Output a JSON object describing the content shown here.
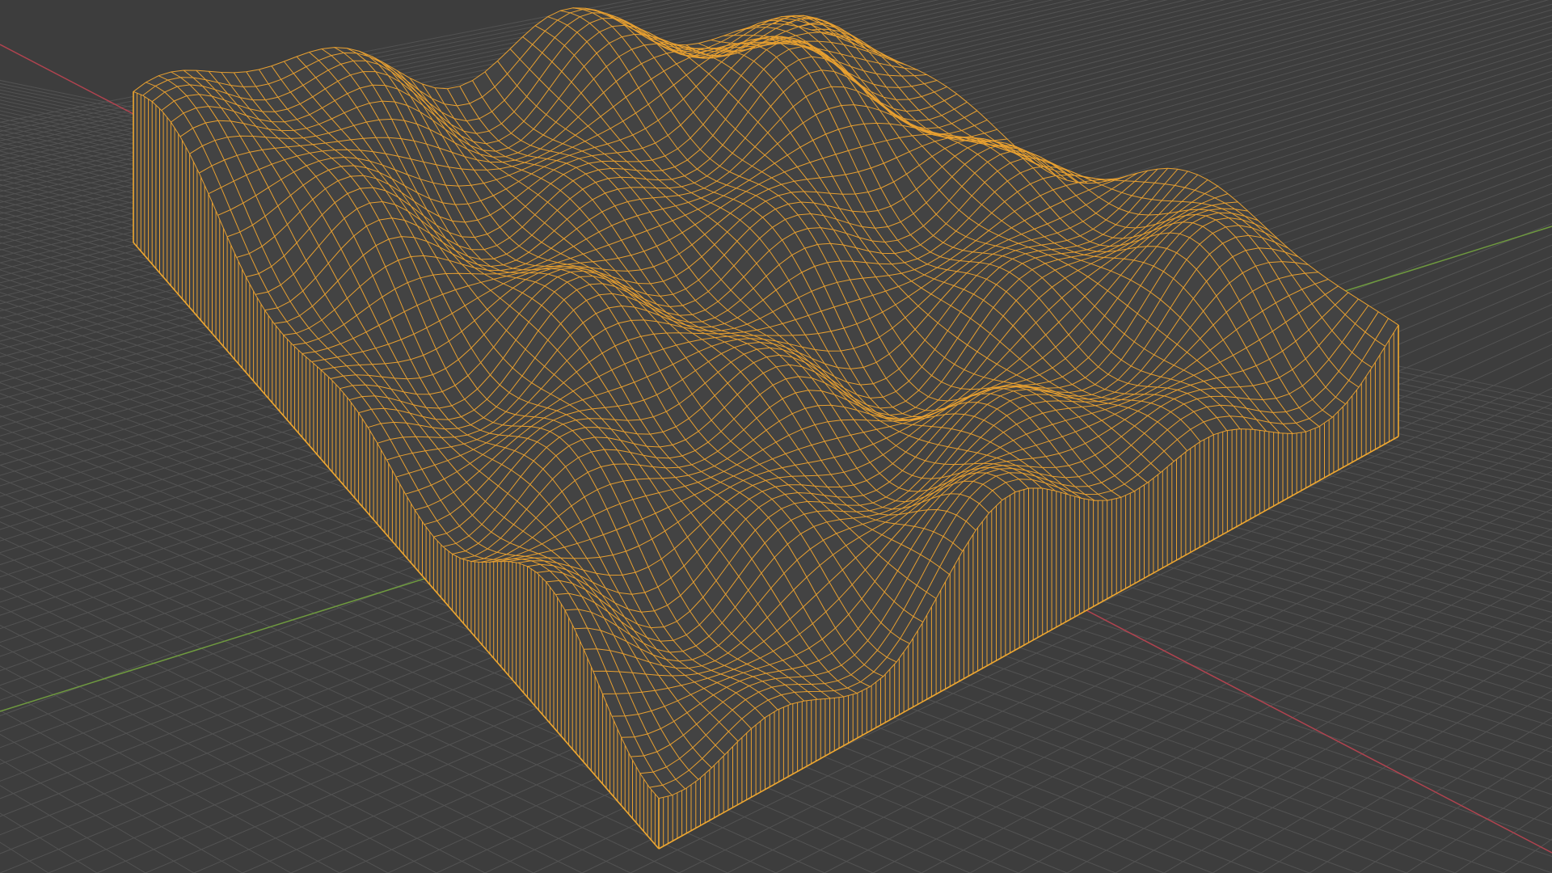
{
  "viewport": {
    "background": "#3d3d3d",
    "grid_color": "#555555",
    "x_axis_color": "#b0434f",
    "y_axis_color": "#6f9a3f",
    "selection_color": "#e8a030",
    "mode": "wireframe",
    "object": "terrain-mesh",
    "object_selected": true
  }
}
